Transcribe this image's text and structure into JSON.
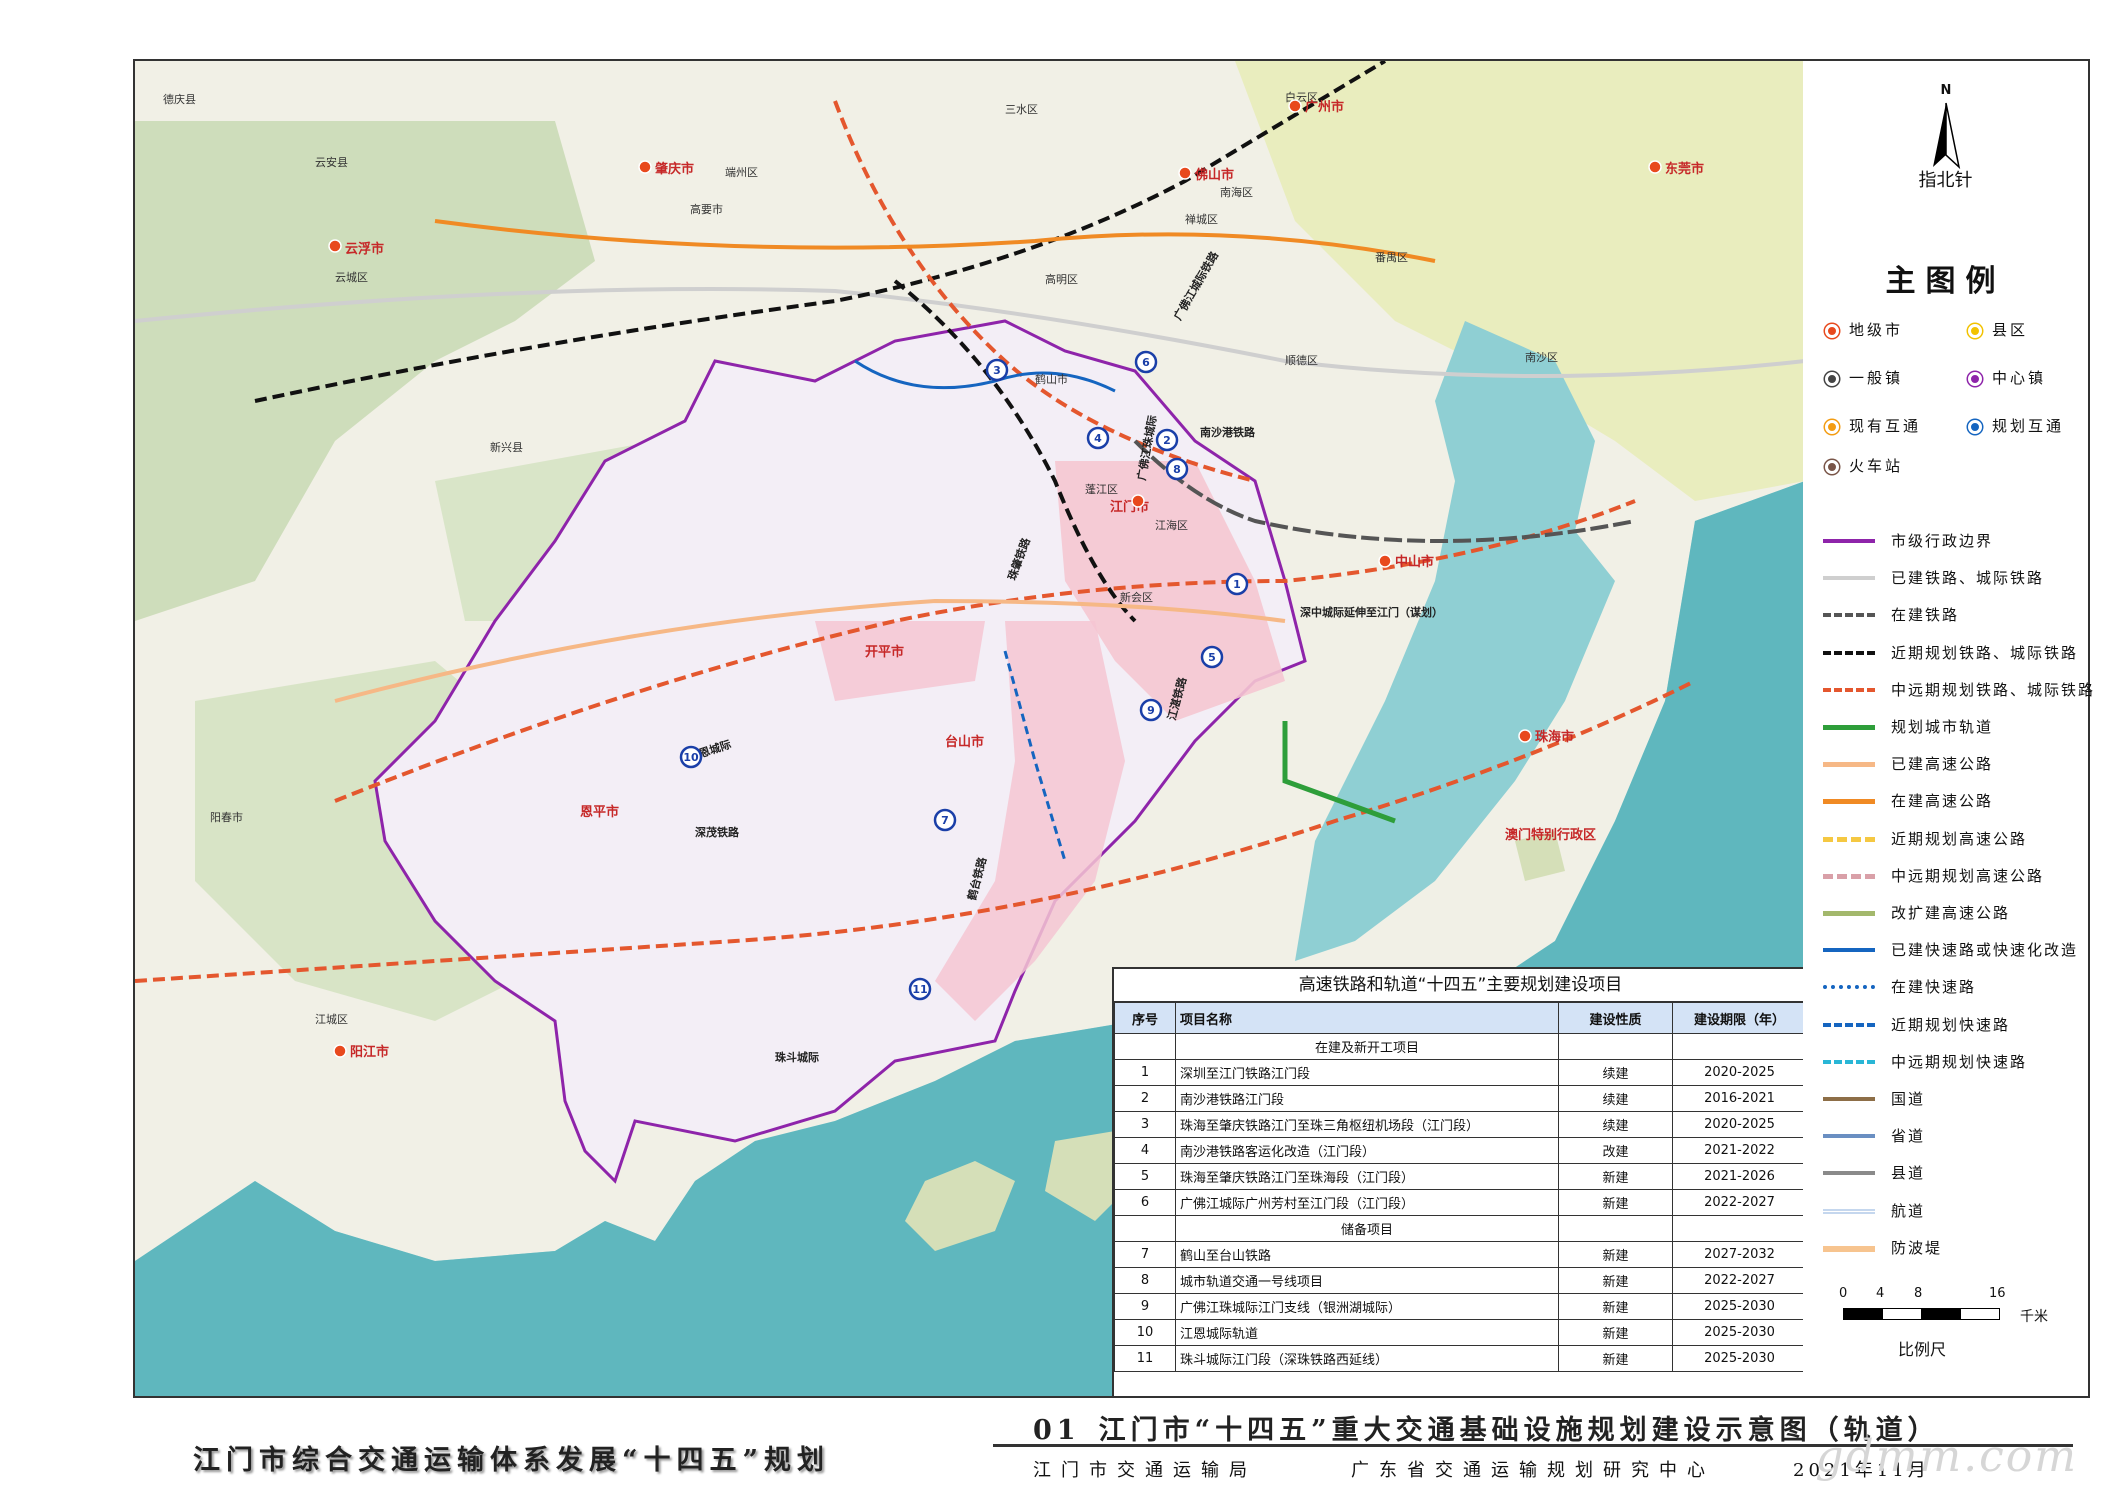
{
  "map": {
    "place_labels": [
      "德庆县",
      "三水区",
      "白云区",
      "云安县",
      "肇庆市",
      "端州区",
      "佛山市",
      "广州市",
      "南海区",
      "东莞市",
      "云浮市",
      "云城区",
      "高要市",
      "高明区",
      "禅城区",
      "番禺区",
      "顺德区",
      "南沙区",
      "鹤山市",
      "江门市",
      "蓬江区",
      "江海区",
      "新会区",
      "开平市",
      "台山市",
      "恩平市",
      "新兴县",
      "阳春市",
      "阳江市",
      "江城区",
      "中山市",
      "珠海市",
      "澳门特别行政区"
    ],
    "rail_labels": [
      "南沙港铁路",
      "深中城际延伸至江门（谋划）",
      "江恩城际",
      "深茂铁路",
      "珠斗城际",
      "广佛江城际铁路",
      "珠肇铁路",
      "江湛铁路",
      "鹤台铁路",
      "广佛江珠城际"
    ],
    "project_numbers": [
      "1",
      "2",
      "3",
      "4",
      "5",
      "6",
      "7",
      "8",
      "9",
      "10",
      "11"
    ]
  },
  "legend": {
    "north_letter": "N",
    "north_label": "指北针",
    "title": "主图例",
    "point_items": [
      {
        "label": "地级市",
        "color": "#e8491d",
        "icon": "prefecture-city-icon"
      },
      {
        "label": "县区",
        "color": "#f2c200",
        "icon": "county-district-icon"
      },
      {
        "label": "一般镇",
        "color": "#444444",
        "icon": "town-icon"
      },
      {
        "label": "中心镇",
        "color": "#8e24aa",
        "icon": "central-town-icon"
      },
      {
        "label": "现有互通",
        "color": "#f39c12",
        "icon": "existing-interchange-icon"
      },
      {
        "label": "规划互通",
        "color": "#1565c0",
        "icon": "planned-interchange-icon"
      },
      {
        "label": "火车站",
        "color": "#795548",
        "icon": "train-station-icon"
      }
    ],
    "line_items": [
      {
        "label": "市级行政边界",
        "color": "#8e24aa",
        "style": "solid",
        "width": 4
      },
      {
        "label": "已建铁路、城际铁路",
        "color": "#cfcfcf",
        "style": "solid",
        "width": 4
      },
      {
        "label": "在建铁路",
        "color": "#555555",
        "style": "dashed",
        "width": 4
      },
      {
        "label": "近期规划铁路、城际铁路",
        "color": "#111111",
        "style": "dashed",
        "width": 4
      },
      {
        "label": "中远期规划铁路、城际铁路",
        "color": "#e4572e",
        "style": "dashed",
        "width": 4
      },
      {
        "label": "规划城市轨道",
        "color": "#2e9e3a",
        "style": "solid",
        "width": 5
      },
      {
        "label": "已建高速公路",
        "color": "#f6b886",
        "style": "solid",
        "width": 5
      },
      {
        "label": "在建高速公路",
        "color": "#f08a24",
        "style": "solid",
        "width": 5
      },
      {
        "label": "近期规划高速公路",
        "color": "#f5c842",
        "style": "dashed",
        "width": 5
      },
      {
        "label": "中远期规划高速公路",
        "color": "#d9a0a8",
        "style": "dashed",
        "width": 5
      },
      {
        "label": "改扩建高速公路",
        "color": "#a3b86c",
        "style": "solid",
        "width": 5
      },
      {
        "label": "已建快速路或快速化改造",
        "color": "#1565c0",
        "style": "solid",
        "width": 4
      },
      {
        "label": "在建快速路",
        "color": "#1565c0",
        "style": "dotted",
        "width": 4
      },
      {
        "label": "近期规划快速路",
        "color": "#1565c0",
        "style": "dashed",
        "width": 4
      },
      {
        "label": "中远期规划快速路",
        "color": "#29b6d6",
        "style": "dashed",
        "width": 4
      },
      {
        "label": "国道",
        "color": "#8d6e47",
        "style": "solid",
        "width": 4
      },
      {
        "label": "省道",
        "color": "#6a8fc2",
        "style": "solid",
        "width": 4
      },
      {
        "label": "县道",
        "color": "#8a8a8a",
        "style": "solid",
        "width": 4
      },
      {
        "label": "航道",
        "color": "#c5d7ee",
        "style": "double",
        "width": 5
      },
      {
        "label": "防波堤",
        "color": "#f7c48f",
        "style": "solid",
        "width": 6
      }
    ],
    "scale": {
      "ticks": [
        "0",
        "4",
        "8",
        "16"
      ],
      "unit": "千米",
      "title": "比例尺"
    }
  },
  "project_table": {
    "title": "高速铁路和轨道“十四五”主要规划建设项目",
    "headers": {
      "no": "序号",
      "name": "项目名称",
      "status": "建设性质",
      "period": "建设期限（年）"
    },
    "sections": [
      {
        "section_title": "在建及新开工项目",
        "rows": [
          {
            "no": "1",
            "name": "深圳至江门铁路江门段",
            "status": "续建",
            "period": "2020-2025"
          },
          {
            "no": "2",
            "name": "南沙港铁路江门段",
            "status": "续建",
            "period": "2016-2021"
          },
          {
            "no": "3",
            "name": "珠海至肇庆铁路江门至珠三角枢纽机场段（江门段）",
            "status": "续建",
            "period": "2020-2025"
          },
          {
            "no": "4",
            "name": "南沙港铁路客运化改造（江门段）",
            "status": "改建",
            "period": "2021-2022"
          },
          {
            "no": "5",
            "name": "珠海至肇庆铁路江门至珠海段（江门段）",
            "status": "新建",
            "period": "2021-2026"
          },
          {
            "no": "6",
            "name": "广佛江城际广州芳村至江门段（江门段）",
            "status": "新建",
            "period": "2022-2027"
          }
        ]
      },
      {
        "section_title": "储备项目",
        "rows": [
          {
            "no": "7",
            "name": "鹤山至台山铁路",
            "status": "新建",
            "period": "2027-2032"
          },
          {
            "no": "8",
            "name": "城市轨道交通一号线项目",
            "status": "新建",
            "period": "2022-2027"
          },
          {
            "no": "9",
            "name": "广佛江珠城际江门支线（银洲湖城际）",
            "status": "新建",
            "period": "2025-2030"
          },
          {
            "no": "10",
            "name": "江恩城际轨道",
            "status": "新建",
            "period": "2025-2030"
          },
          {
            "no": "11",
            "name": "珠斗城际江门段（深珠铁路西延线）",
            "status": "新建",
            "period": "2025-2030"
          }
        ]
      }
    ]
  },
  "title_block": {
    "plan_title": "江门市综合交通运输体系发展“十四五”规划",
    "map_number": "01",
    "map_title": "江门市“十四五”重大交通基础设施规划建设示意图（轨道）",
    "issuer_1": "江门市交通运输局",
    "issuer_2": "广东省交通运输规划研究中心",
    "date": "2021年11月",
    "watermark": "gdmm.com"
  }
}
